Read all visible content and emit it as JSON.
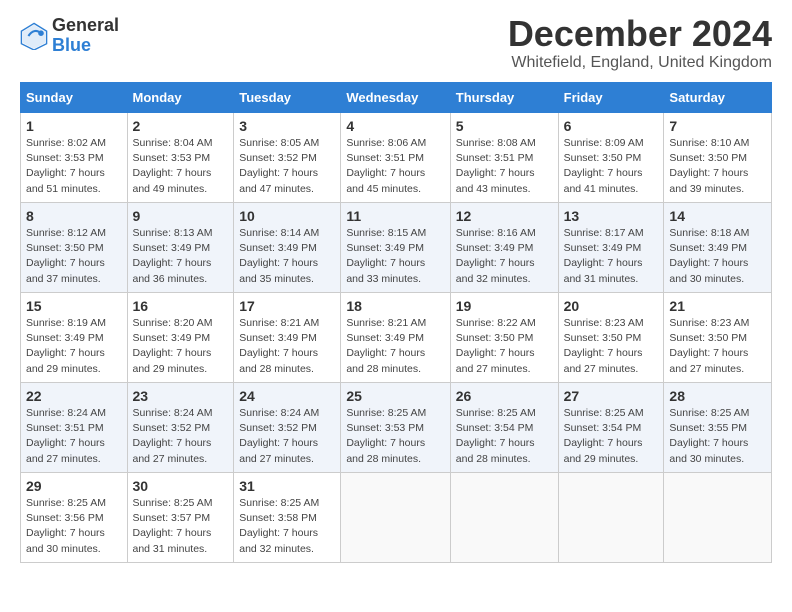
{
  "logo": {
    "general": "General",
    "blue": "Blue"
  },
  "title": "December 2024",
  "location": "Whitefield, England, United Kingdom",
  "headers": [
    "Sunday",
    "Monday",
    "Tuesday",
    "Wednesday",
    "Thursday",
    "Friday",
    "Saturday"
  ],
  "weeks": [
    [
      {
        "day": "1",
        "sunrise": "8:02 AM",
        "sunset": "3:53 PM",
        "daylight": "7 hours and 51 minutes."
      },
      {
        "day": "2",
        "sunrise": "8:04 AM",
        "sunset": "3:53 PM",
        "daylight": "7 hours and 49 minutes."
      },
      {
        "day": "3",
        "sunrise": "8:05 AM",
        "sunset": "3:52 PM",
        "daylight": "7 hours and 47 minutes."
      },
      {
        "day": "4",
        "sunrise": "8:06 AM",
        "sunset": "3:51 PM",
        "daylight": "7 hours and 45 minutes."
      },
      {
        "day": "5",
        "sunrise": "8:08 AM",
        "sunset": "3:51 PM",
        "daylight": "7 hours and 43 minutes."
      },
      {
        "day": "6",
        "sunrise": "8:09 AM",
        "sunset": "3:50 PM",
        "daylight": "7 hours and 41 minutes."
      },
      {
        "day": "7",
        "sunrise": "8:10 AM",
        "sunset": "3:50 PM",
        "daylight": "7 hours and 39 minutes."
      }
    ],
    [
      {
        "day": "8",
        "sunrise": "8:12 AM",
        "sunset": "3:50 PM",
        "daylight": "7 hours and 37 minutes."
      },
      {
        "day": "9",
        "sunrise": "8:13 AM",
        "sunset": "3:49 PM",
        "daylight": "7 hours and 36 minutes."
      },
      {
        "day": "10",
        "sunrise": "8:14 AM",
        "sunset": "3:49 PM",
        "daylight": "7 hours and 35 minutes."
      },
      {
        "day": "11",
        "sunrise": "8:15 AM",
        "sunset": "3:49 PM",
        "daylight": "7 hours and 33 minutes."
      },
      {
        "day": "12",
        "sunrise": "8:16 AM",
        "sunset": "3:49 PM",
        "daylight": "7 hours and 32 minutes."
      },
      {
        "day": "13",
        "sunrise": "8:17 AM",
        "sunset": "3:49 PM",
        "daylight": "7 hours and 31 minutes."
      },
      {
        "day": "14",
        "sunrise": "8:18 AM",
        "sunset": "3:49 PM",
        "daylight": "7 hours and 30 minutes."
      }
    ],
    [
      {
        "day": "15",
        "sunrise": "8:19 AM",
        "sunset": "3:49 PM",
        "daylight": "7 hours and 29 minutes."
      },
      {
        "day": "16",
        "sunrise": "8:20 AM",
        "sunset": "3:49 PM",
        "daylight": "7 hours and 29 minutes."
      },
      {
        "day": "17",
        "sunrise": "8:21 AM",
        "sunset": "3:49 PM",
        "daylight": "7 hours and 28 minutes."
      },
      {
        "day": "18",
        "sunrise": "8:21 AM",
        "sunset": "3:49 PM",
        "daylight": "7 hours and 28 minutes."
      },
      {
        "day": "19",
        "sunrise": "8:22 AM",
        "sunset": "3:50 PM",
        "daylight": "7 hours and 27 minutes."
      },
      {
        "day": "20",
        "sunrise": "8:23 AM",
        "sunset": "3:50 PM",
        "daylight": "7 hours and 27 minutes."
      },
      {
        "day": "21",
        "sunrise": "8:23 AM",
        "sunset": "3:50 PM",
        "daylight": "7 hours and 27 minutes."
      }
    ],
    [
      {
        "day": "22",
        "sunrise": "8:24 AM",
        "sunset": "3:51 PM",
        "daylight": "7 hours and 27 minutes."
      },
      {
        "day": "23",
        "sunrise": "8:24 AM",
        "sunset": "3:52 PM",
        "daylight": "7 hours and 27 minutes."
      },
      {
        "day": "24",
        "sunrise": "8:24 AM",
        "sunset": "3:52 PM",
        "daylight": "7 hours and 27 minutes."
      },
      {
        "day": "25",
        "sunrise": "8:25 AM",
        "sunset": "3:53 PM",
        "daylight": "7 hours and 28 minutes."
      },
      {
        "day": "26",
        "sunrise": "8:25 AM",
        "sunset": "3:54 PM",
        "daylight": "7 hours and 28 minutes."
      },
      {
        "day": "27",
        "sunrise": "8:25 AM",
        "sunset": "3:54 PM",
        "daylight": "7 hours and 29 minutes."
      },
      {
        "day": "28",
        "sunrise": "8:25 AM",
        "sunset": "3:55 PM",
        "daylight": "7 hours and 30 minutes."
      }
    ],
    [
      {
        "day": "29",
        "sunrise": "8:25 AM",
        "sunset": "3:56 PM",
        "daylight": "7 hours and 30 minutes."
      },
      {
        "day": "30",
        "sunrise": "8:25 AM",
        "sunset": "3:57 PM",
        "daylight": "7 hours and 31 minutes."
      },
      {
        "day": "31",
        "sunrise": "8:25 AM",
        "sunset": "3:58 PM",
        "daylight": "7 hours and 32 minutes."
      },
      null,
      null,
      null,
      null
    ]
  ]
}
